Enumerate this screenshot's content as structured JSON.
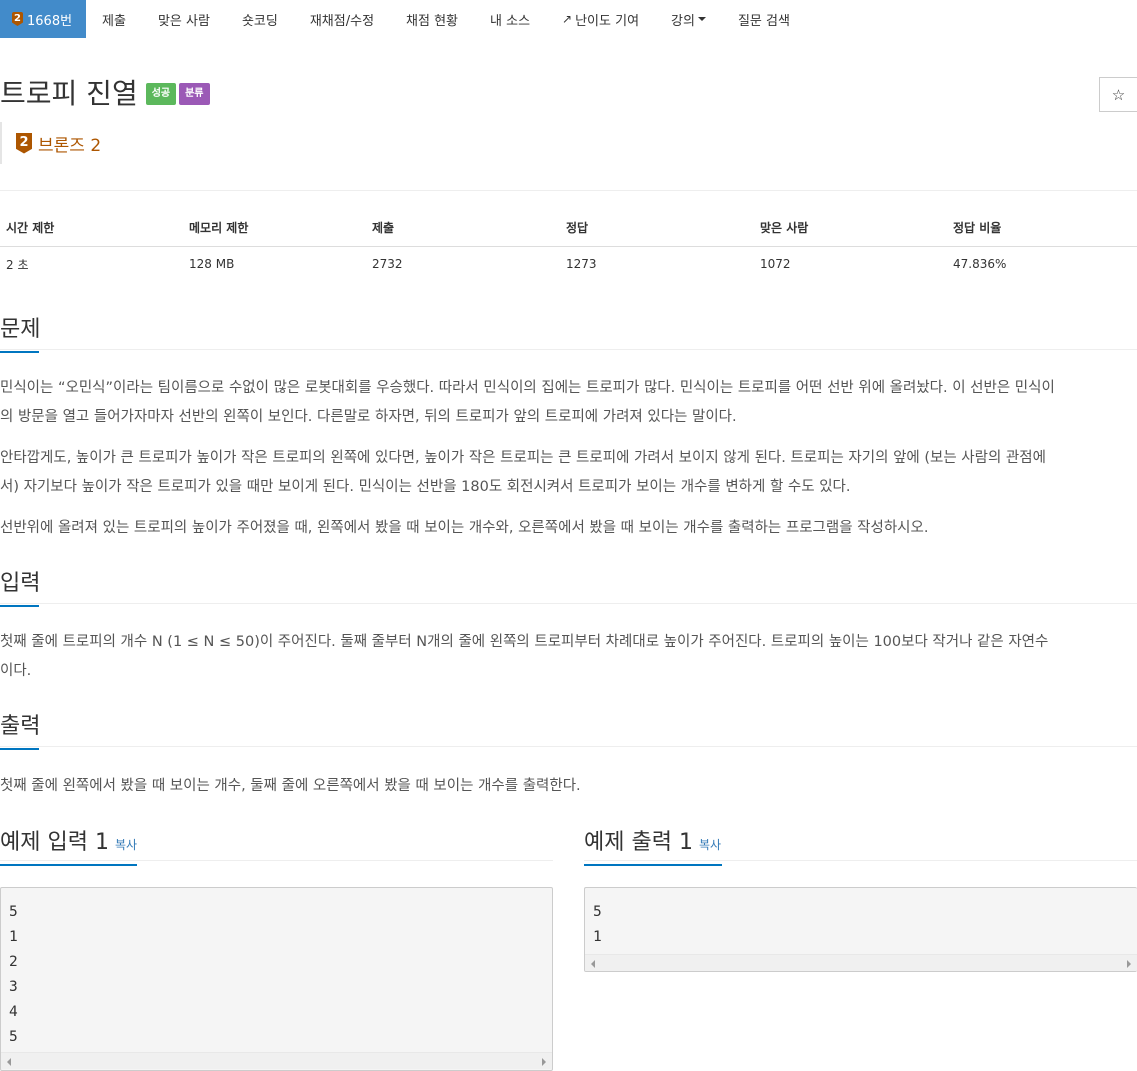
{
  "nav": {
    "items": [
      {
        "label": "1668번",
        "badge": "2"
      },
      {
        "label": "제출"
      },
      {
        "label": "맞은 사람"
      },
      {
        "label": "숏코딩"
      },
      {
        "label": "재채점/수정"
      },
      {
        "label": "채점 현황"
      },
      {
        "label": "내 소스"
      },
      {
        "label": "난이도 기여"
      },
      {
        "label": "강의"
      },
      {
        "label": "질문 검색"
      }
    ]
  },
  "problem": {
    "title": "트로피 진열",
    "label_success": "성공",
    "label_category": "분류",
    "star": "☆",
    "tier_badge": "2",
    "tier_text": "브론즈 2"
  },
  "stats": {
    "headers": [
      "시간 제한",
      "메모리 제한",
      "제출",
      "정답",
      "맞은 사람",
      "정답 비율"
    ],
    "values": [
      "2 초",
      "128 MB",
      "2732",
      "1273",
      "1072",
      "47.836%"
    ]
  },
  "sections": {
    "problem_title": "문제",
    "problem_lines": [
      "민식이는 “오민식”이라는 팀이름으로 수없이 많은 로봇대회를 우승했다. 따라서 민식이의 집에는 트로피가 많다. 민식이는 트로피를 어떤 선반 위에 올려놨다. 이 선반은 민식이",
      "의 방문을 열고 들어가자마자 선반의 왼쪽이 보인다. 다른말로 하자면, 뒤의 트로피가 앞의 트로피에 가려져 있다는 말이다.",
      "안타깝게도, 높이가 큰 트로피가 높이가 작은 트로피의 왼쪽에 있다면, 높이가 작은 트로피는 큰 트로피에 가려서 보이지 않게 된다. 트로피는 자기의 앞에 (보는 사람의 관점에",
      "서) 자기보다 높이가 작은 트로피가 있을 때만 보이게 된다. 민식이는 선반을 180도 회전시켜서 트로피가 보이는 개수를 변하게 할 수도 있다.",
      "선반위에 올려져 있는 트로피의 높이가 주어졌을 때, 왼쪽에서 봤을 때 보이는 개수와, 오른쪽에서 봤을 때 보이는 개수를 출력하는 프로그램을 작성하시오."
    ],
    "input_title": "입력",
    "input_lines": [
      "첫째 줄에 트로피의 개수 N (1 ≤ N ≤ 50)이 주어진다. 둘째 줄부터 N개의 줄에 왼쪽의 트로피부터 차례대로 높이가 주어진다. 트로피의 높이는 100보다 작거나 같은 자연수",
      "이다."
    ],
    "output_title": "출력",
    "output_lines": [
      "첫째 줄에 왼쪽에서 봤을 때 보이는 개수, 둘째 줄에 오른쪽에서 봤을 때 보이는 개수를 출력한다."
    ]
  },
  "samples": {
    "input_title": "예제 입력 1",
    "output_title": "예제 출력 1",
    "copy_label": "복사",
    "input_lines": [
      "5",
      "1",
      "2",
      "3",
      "4",
      "5"
    ],
    "output_lines": [
      "5",
      "1"
    ]
  }
}
